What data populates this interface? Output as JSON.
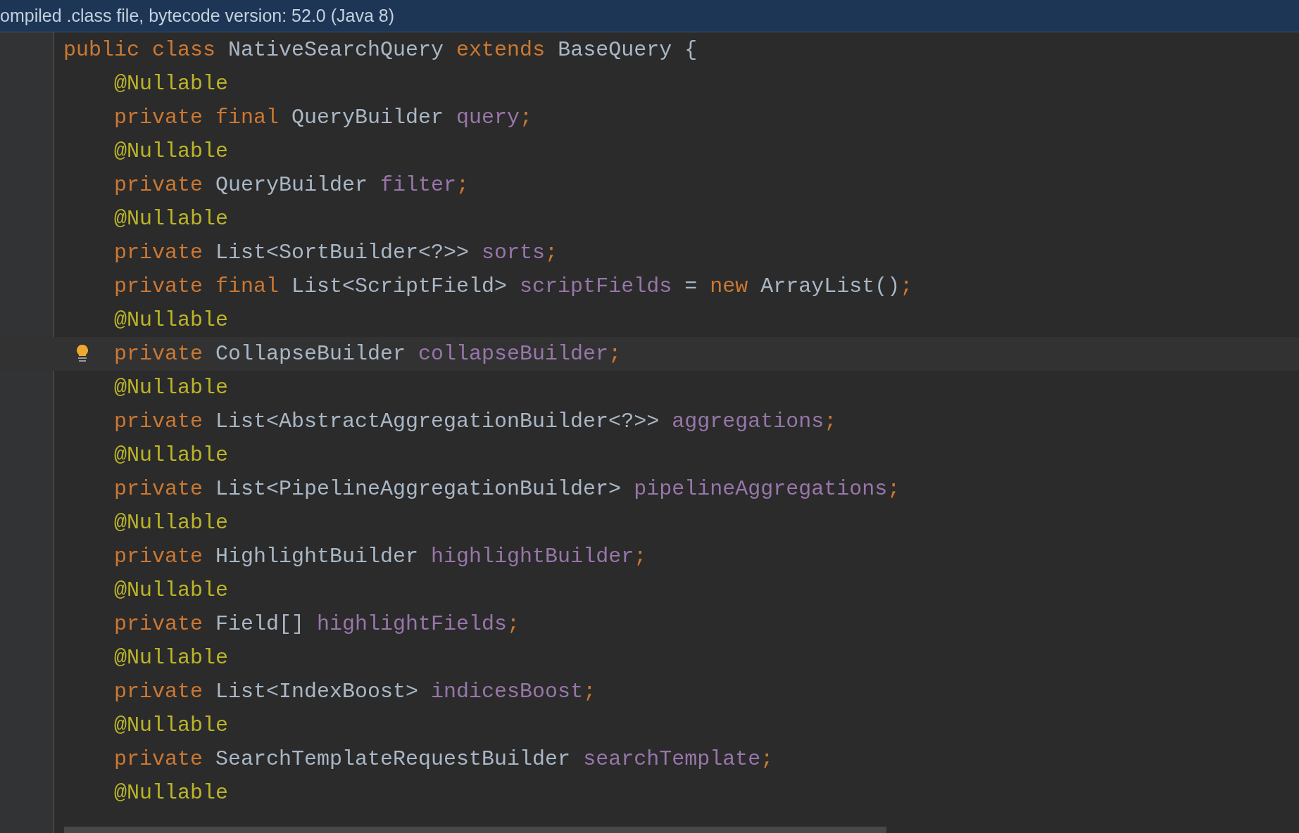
{
  "banner": {
    "text": "ompiled .class file, bytecode version: 52.0 (Java 8)"
  },
  "lines": [
    {
      "indented": false,
      "current": false,
      "bulb": false,
      "tokens": [
        {
          "kind": "kw",
          "text": "public class "
        },
        {
          "kind": "plain",
          "text": "NativeSearchQuery "
        },
        {
          "kind": "kw",
          "text": "extends "
        },
        {
          "kind": "plain",
          "text": "BaseQuery {"
        }
      ]
    },
    {
      "indented": true,
      "current": false,
      "bulb": false,
      "tokens": [
        {
          "kind": "ann",
          "text": "@Nullable"
        }
      ]
    },
    {
      "indented": true,
      "current": false,
      "bulb": false,
      "tokens": [
        {
          "kind": "kw",
          "text": "private final "
        },
        {
          "kind": "plain",
          "text": "QueryBuilder "
        },
        {
          "kind": "field",
          "text": "query"
        },
        {
          "kind": "kw",
          "text": ";"
        }
      ]
    },
    {
      "indented": true,
      "current": false,
      "bulb": false,
      "tokens": [
        {
          "kind": "ann",
          "text": "@Nullable"
        }
      ]
    },
    {
      "indented": true,
      "current": false,
      "bulb": false,
      "tokens": [
        {
          "kind": "kw",
          "text": "private "
        },
        {
          "kind": "plain",
          "text": "QueryBuilder "
        },
        {
          "kind": "field",
          "text": "filter"
        },
        {
          "kind": "kw",
          "text": ";"
        }
      ]
    },
    {
      "indented": true,
      "current": false,
      "bulb": false,
      "tokens": [
        {
          "kind": "ann",
          "text": "@Nullable"
        }
      ]
    },
    {
      "indented": true,
      "current": false,
      "bulb": false,
      "tokens": [
        {
          "kind": "kw",
          "text": "private "
        },
        {
          "kind": "plain",
          "text": "List<SortBuilder<?>> "
        },
        {
          "kind": "field",
          "text": "sorts"
        },
        {
          "kind": "kw",
          "text": ";"
        }
      ]
    },
    {
      "indented": true,
      "current": false,
      "bulb": false,
      "tokens": [
        {
          "kind": "kw",
          "text": "private final "
        },
        {
          "kind": "plain",
          "text": "List<ScriptField> "
        },
        {
          "kind": "field",
          "text": "scriptFields"
        },
        {
          "kind": "plain",
          "text": " = "
        },
        {
          "kind": "kw",
          "text": "new "
        },
        {
          "kind": "plain",
          "text": "ArrayList()"
        },
        {
          "kind": "kw",
          "text": ";"
        }
      ]
    },
    {
      "indented": true,
      "current": false,
      "bulb": false,
      "tokens": [
        {
          "kind": "ann",
          "text": "@Nullable"
        }
      ]
    },
    {
      "indented": true,
      "current": true,
      "bulb": true,
      "tokens": [
        {
          "kind": "kw",
          "text": "private "
        },
        {
          "kind": "plain",
          "text": "CollapseBuilder "
        },
        {
          "kind": "field",
          "text": "collapseBuilder"
        },
        {
          "kind": "kw",
          "text": ";"
        }
      ]
    },
    {
      "indented": true,
      "current": false,
      "bulb": false,
      "tokens": [
        {
          "kind": "ann",
          "text": "@Nullable"
        }
      ]
    },
    {
      "indented": true,
      "current": false,
      "bulb": false,
      "tokens": [
        {
          "kind": "kw",
          "text": "private "
        },
        {
          "kind": "plain",
          "text": "List<AbstractAggregationBuilder<?>> "
        },
        {
          "kind": "field",
          "text": "aggregations"
        },
        {
          "kind": "kw",
          "text": ";"
        }
      ]
    },
    {
      "indented": true,
      "current": false,
      "bulb": false,
      "tokens": [
        {
          "kind": "ann",
          "text": "@Nullable"
        }
      ]
    },
    {
      "indented": true,
      "current": false,
      "bulb": false,
      "tokens": [
        {
          "kind": "kw",
          "text": "private "
        },
        {
          "kind": "plain",
          "text": "List<PipelineAggregationBuilder> "
        },
        {
          "kind": "field",
          "text": "pipelineAggregations"
        },
        {
          "kind": "kw",
          "text": ";"
        }
      ]
    },
    {
      "indented": true,
      "current": false,
      "bulb": false,
      "tokens": [
        {
          "kind": "ann",
          "text": "@Nullable"
        }
      ]
    },
    {
      "indented": true,
      "current": false,
      "bulb": false,
      "tokens": [
        {
          "kind": "kw",
          "text": "private "
        },
        {
          "kind": "plain",
          "text": "HighlightBuilder "
        },
        {
          "kind": "field",
          "text": "highlightBuilder"
        },
        {
          "kind": "kw",
          "text": ";"
        }
      ]
    },
    {
      "indented": true,
      "current": false,
      "bulb": false,
      "tokens": [
        {
          "kind": "ann",
          "text": "@Nullable"
        }
      ]
    },
    {
      "indented": true,
      "current": false,
      "bulb": false,
      "tokens": [
        {
          "kind": "kw",
          "text": "private "
        },
        {
          "kind": "plain",
          "text": "Field[] "
        },
        {
          "kind": "field",
          "text": "highlightFields"
        },
        {
          "kind": "kw",
          "text": ";"
        }
      ]
    },
    {
      "indented": true,
      "current": false,
      "bulb": false,
      "tokens": [
        {
          "kind": "ann",
          "text": "@Nullable"
        }
      ]
    },
    {
      "indented": true,
      "current": false,
      "bulb": false,
      "tokens": [
        {
          "kind": "kw",
          "text": "private "
        },
        {
          "kind": "plain",
          "text": "List<IndexBoost> "
        },
        {
          "kind": "field",
          "text": "indicesBoost"
        },
        {
          "kind": "kw",
          "text": ";"
        }
      ]
    },
    {
      "indented": true,
      "current": false,
      "bulb": false,
      "tokens": [
        {
          "kind": "ann",
          "text": "@Nullable"
        }
      ]
    },
    {
      "indented": true,
      "current": false,
      "bulb": false,
      "tokens": [
        {
          "kind": "kw",
          "text": "private "
        },
        {
          "kind": "plain",
          "text": "SearchTemplateRequestBuilder "
        },
        {
          "kind": "field",
          "text": "searchTemplate"
        },
        {
          "kind": "kw",
          "text": ";"
        }
      ]
    },
    {
      "indented": true,
      "current": false,
      "bulb": false,
      "tokens": [
        {
          "kind": "ann",
          "text": "@Nullable"
        }
      ]
    }
  ]
}
